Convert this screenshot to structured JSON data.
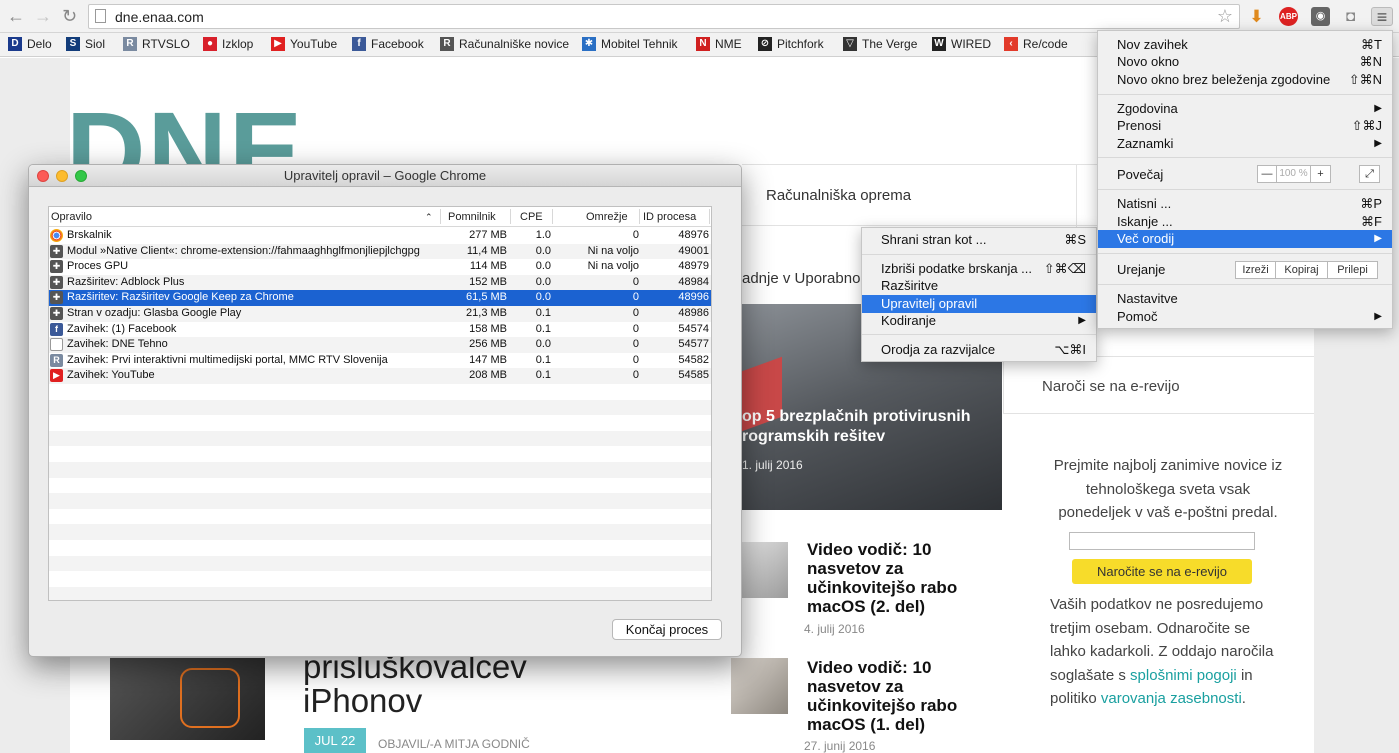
{
  "browser": {
    "url": "dne.enaa.com",
    "extensions": [
      {
        "name": "download-icon",
        "text": "⬇"
      },
      {
        "name": "adblock-icon",
        "text": "ABP"
      },
      {
        "name": "keep-icon",
        "text": "💡"
      },
      {
        "name": "camera-icon",
        "text": "📷"
      },
      {
        "name": "menu-icon",
        "text": "≡"
      }
    ]
  },
  "bookmarks": [
    {
      "label": "Delo",
      "icon": "D",
      "color": "#1a3a8c"
    },
    {
      "label": "Siol",
      "icon": "S",
      "color": "#123c7a"
    },
    {
      "label": "RTVSLO",
      "icon": "R",
      "color": "#7a8aa0"
    },
    {
      "label": "Izklop",
      "icon": "●",
      "color": "#d8202b"
    },
    {
      "label": "YouTube",
      "icon": "▶",
      "color": "#e02020"
    },
    {
      "label": "Facebook",
      "icon": "f",
      "color": "#3b5998"
    },
    {
      "label": "Računalniške novice",
      "icon": "R",
      "color": "#555555"
    },
    {
      "label": "Mobitel Tehnik",
      "icon": "✱",
      "color": "#2a6fc4"
    },
    {
      "label": "NME",
      "icon": "N",
      "color": "#d02020"
    },
    {
      "label": "Pitchfork",
      "icon": "⊘",
      "color": "#222222"
    },
    {
      "label": "The Verge",
      "icon": "▽",
      "color": "#333333"
    },
    {
      "label": "WIRED",
      "icon": "W",
      "color": "#222222"
    },
    {
      "label": "Re/code",
      "icon": "‹",
      "color": "#e23a2a"
    }
  ],
  "site": {
    "logo": "DNE",
    "nav_item": "Računalniška oprema",
    "section_heading": "adnje v Uporabno",
    "hero_title_line1": "op 5 brezplačnih protivirusnih",
    "hero_title_line2": "rogramskih rešitev",
    "hero_date": "1. julij 2016",
    "articles": [
      {
        "title": "Video vodič: 10 nasvetov za učinkovitejšo rabo macOS (2. del)",
        "date": "4. julij 2016"
      },
      {
        "title": "Video vodič: 10 nasvetov za učinkovitejšo rabo macOS (1. del)",
        "date": "27. junij 2016"
      }
    ],
    "bottom_title_line1": "prisluškovalcev",
    "bottom_title_line2": "iPhonov",
    "bottom_date_badge": "JUL 22",
    "bottom_author": "OBJAVIL/-A MITJA GODNIČ",
    "newsletter_heading": "Naroči se na e-revijo",
    "newsletter_text": "Prejmite najbolj zanimive novice iz tehnološkega sveta vsak ponedeljek v vaš e-poštni predal.",
    "newsletter_button": "Naročite se na e-revijo",
    "privacy_text_1": "Vaših podatkov ne posredujemo tretjim osebam. Odnaročite se lahko kadarkoli. Z oddajo naročila soglašate s ",
    "privacy_link_1": "splošnimi pogoji",
    "privacy_text_2": " in politiko ",
    "privacy_link_2": "varovanja zasebnosti",
    "privacy_text_3": "."
  },
  "task_manager": {
    "title": "Upravitelj opravil – Google Chrome",
    "columns": [
      "Opravilo",
      "Pomnilnik",
      "CPE",
      "Omrežje",
      "ID procesa"
    ],
    "rows": [
      {
        "task": "Brskalnik",
        "mem": "277 MB",
        "cpu": "1.0",
        "net": "0",
        "pid": "48976",
        "icon": "chrome",
        "selected": false
      },
      {
        "task": "Modul »Native Client«: chrome-extension://fahmaaghhglfmonjliepjlchgpg",
        "mem": "11,4 MB",
        "cpu": "0.0",
        "net": "Ni na voljo",
        "pid": "49001",
        "icon": "puzzle",
        "selected": false
      },
      {
        "task": "Proces GPU",
        "mem": "114 MB",
        "cpu": "0.0",
        "net": "Ni na voljo",
        "pid": "48979",
        "icon": "puzzle",
        "selected": false
      },
      {
        "task": "Razširitev: Adblock Plus",
        "mem": "152 MB",
        "cpu": "0.0",
        "net": "0",
        "pid": "48984",
        "icon": "puzzle",
        "selected": false
      },
      {
        "task": "Razširitev: Razširitev Google Keep za Chrome",
        "mem": "61,5 MB",
        "cpu": "0.0",
        "net": "0",
        "pid": "48996",
        "icon": "puzzle",
        "selected": true
      },
      {
        "task": "Stran v ozadju: Glasba Google Play",
        "mem": "21,3 MB",
        "cpu": "0.1",
        "net": "0",
        "pid": "48986",
        "icon": "puzzle",
        "selected": false
      },
      {
        "task": "Zavihek: (1) Facebook",
        "mem": "158 MB",
        "cpu": "0.1",
        "net": "0",
        "pid": "54574",
        "icon": "facebook",
        "selected": false
      },
      {
        "task": "Zavihek: DNE Tehno",
        "mem": "256 MB",
        "cpu": "0.0",
        "net": "0",
        "pid": "54577",
        "icon": "page",
        "selected": false
      },
      {
        "task": "Zavihek: Prvi interaktivni multimedijski portal, MMC RTV Slovenija",
        "mem": "147 MB",
        "cpu": "0.1",
        "net": "0",
        "pid": "54582",
        "icon": "rtv",
        "selected": false
      },
      {
        "task": "Zavihek: YouTube",
        "mem": "208 MB",
        "cpu": "0.1",
        "net": "0",
        "pid": "54585",
        "icon": "youtube",
        "selected": false
      }
    ],
    "end_process_button": "Končaj proces"
  },
  "chrome_menu": {
    "new_tab": {
      "label": "Nov zavihek",
      "shortcut": "⌘T"
    },
    "new_window": {
      "label": "Novo okno",
      "shortcut": "⌘N"
    },
    "incognito": {
      "label": "Novo okno brez beleženja zgodovine",
      "shortcut": "⇧⌘N"
    },
    "history": {
      "label": "Zgodovina",
      "shortcut": "▶"
    },
    "downloads": {
      "label": "Prenosi",
      "shortcut": "⇧⌘J"
    },
    "bookmarks": {
      "label": "Zaznamki",
      "shortcut": "▶"
    },
    "zoom": {
      "label": "Povečaj",
      "minus": "—",
      "value": "100 %",
      "plus": "+",
      "fullscreen": "⤢"
    },
    "print": {
      "label": "Natisni ...",
      "shortcut": "⌘P"
    },
    "find": {
      "label": "Iskanje ...",
      "shortcut": "⌘F"
    },
    "more_tools": {
      "label": "Več orodij",
      "shortcut": "▶"
    },
    "edit": {
      "label": "Urejanje",
      "cut": "Izreži",
      "copy": "Kopiraj",
      "paste": "Prilepi"
    },
    "settings": {
      "label": "Nastavitve"
    },
    "help": {
      "label": "Pomoč",
      "shortcut": "▶"
    }
  },
  "more_tools_menu": {
    "save_page": {
      "label": "Shrani stran kot ...",
      "shortcut": "⌘S"
    },
    "clear_data": {
      "label": "Izbriši podatke brskanja ...",
      "shortcut": "⇧⌘⌫"
    },
    "extensions": {
      "label": "Razširitve"
    },
    "task_manager": {
      "label": "Upravitelj opravil"
    },
    "encoding": {
      "label": "Kodiranje",
      "shortcut": "▶"
    },
    "dev_tools": {
      "label": "Orodja za razvijalce",
      "shortcut": "⌥⌘I"
    }
  },
  "colors": {
    "accent": "#2c77e5",
    "selection": "#1b62d1",
    "brand_teal": "#5a9c9a",
    "newsletter_yellow": "#f7dc2a",
    "link": "#1aa0a0"
  }
}
